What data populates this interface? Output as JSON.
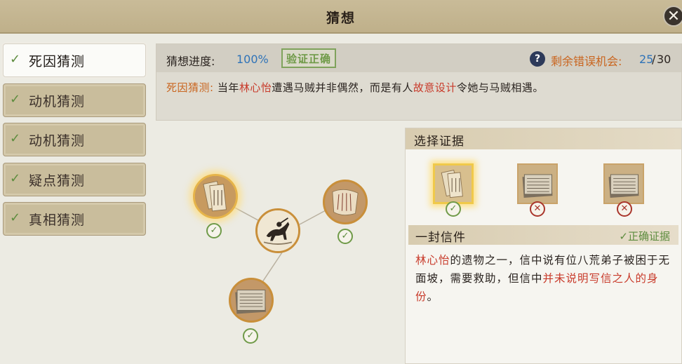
{
  "window": {
    "title": "猜想",
    "close_icon": "close-icon"
  },
  "sidebar": {
    "items": [
      {
        "label": "死因猜测",
        "active": true,
        "checked": true
      },
      {
        "label": "动机猜测",
        "active": false,
        "checked": true
      },
      {
        "label": "动机猜测",
        "active": false,
        "checked": true
      },
      {
        "label": "疑点猜测",
        "active": false,
        "checked": true
      },
      {
        "label": "真相猜测",
        "active": false,
        "checked": true
      }
    ]
  },
  "info": {
    "progress_label": "猜想进度:",
    "progress_value": "100%",
    "stamp": "验证正确",
    "chances_label": "剩余错误机会:",
    "chances_current": "25",
    "chances_sep": "/",
    "chances_max": "30",
    "guess": {
      "prefix": "死因猜测:",
      "t1": " 当年",
      "name": "林心怡",
      "t2": "遭遇马贼并非偶然，而是有人",
      "highlight": "故意设计",
      "t3": "令她与马贼相遇。"
    }
  },
  "graph": {
    "nodes": [
      {
        "name": "letter-node",
        "checked": true
      },
      {
        "name": "horse-rider-node",
        "checked": false
      },
      {
        "name": "scroll-node",
        "checked": true
      },
      {
        "name": "book-node",
        "checked": true
      }
    ]
  },
  "evidence": {
    "header": "选择证据",
    "items": [
      {
        "name": "letter",
        "selected": true,
        "mark": "✓"
      },
      {
        "name": "book-a",
        "selected": false,
        "mark": "✕"
      },
      {
        "name": "book-b",
        "selected": false,
        "mark": "✕"
      }
    ],
    "selected_name": "一封信件",
    "correct_label": "✓正确证据",
    "desc": {
      "r1": "林心怡",
      "t1": "的遗物之一，信中说有位八荒弟子被困于无面坡，需要救助，但信中",
      "r2": "并未说明写信之人的身份",
      "t2": "。"
    }
  },
  "colors": {
    "accent_orange": "#c9651f",
    "accent_red": "#c83a2a",
    "accent_blue": "#2f73b8",
    "check_green": "#5d8c3e"
  }
}
